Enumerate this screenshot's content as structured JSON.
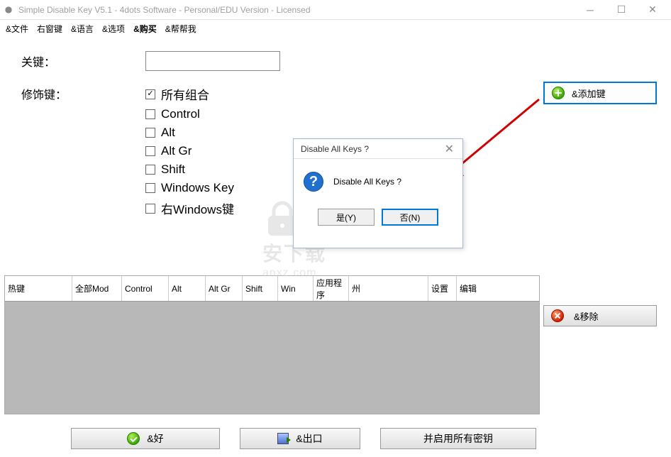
{
  "window": {
    "title": "Simple Disable Key V5.1 - 4dots Software - Personal/EDU Version - Licensed"
  },
  "menubar": {
    "file": "&文件",
    "rightwin": "右窗键",
    "language": "&语言",
    "options": "&选项",
    "buy": "&购买",
    "help": "&帮帮我"
  },
  "labels": {
    "key": "关键：",
    "modifier": "修饰键："
  },
  "modifiers": {
    "all": "所有组合",
    "control": "Control",
    "alt": "Alt",
    "altgr": "Alt Gr",
    "shift": "Shift",
    "winkey": "Windows Key",
    "rightwin": "右Windows键"
  },
  "buttons": {
    "add": "&添加键",
    "remove": "&移除",
    "ok": "&好",
    "exit": "&出口",
    "enable_all": "并启用所有密钥"
  },
  "dialog": {
    "title": "Disable All Keys ?",
    "message": "Disable All Keys ?",
    "yes": "是(Y)",
    "no": "否(N)"
  },
  "table": {
    "headers": {
      "hotkey": "热键",
      "allmod": "全部Mod",
      "control": "Control",
      "alt": "Alt",
      "altgr": "Alt Gr",
      "shift": "Shift",
      "win": "Win",
      "app": "应用程序",
      "state": "州",
      "settings": "设置",
      "edit": "编辑"
    }
  },
  "watermark": {
    "main": "安下载",
    "sub": "anxz.com"
  }
}
